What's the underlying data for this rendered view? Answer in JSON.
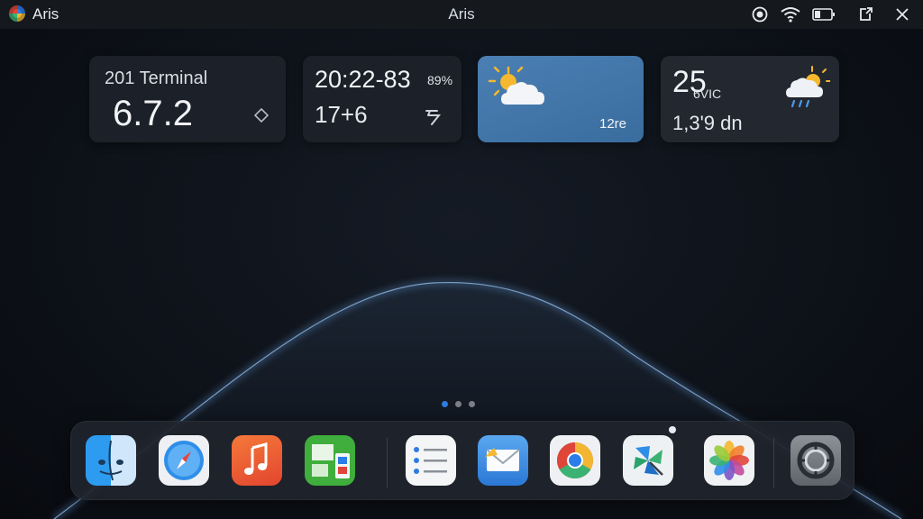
{
  "titlebar": {
    "app_name": "Aris",
    "window_title": "Aris",
    "controls": [
      "record-icon",
      "wifi-icon",
      "battery-icon",
      "share-icon",
      "close-icon"
    ]
  },
  "widgets": {
    "terminal": {
      "title": "201 Terminal",
      "value": "6.7.2"
    },
    "clock": {
      "time": "20:22-83",
      "percent": "89%",
      "secondary": "17+6"
    },
    "weather_sunny": {
      "value": "12re"
    },
    "weather_rain": {
      "temp": "25",
      "sub": "6VIC",
      "value": "1,3'9 dn"
    }
  },
  "pager": {
    "pages": 3,
    "active": 0
  },
  "dock": {
    "apps": [
      "finder-icon",
      "safari-compass-icon",
      "music-icon",
      "numbers-icon",
      "reminders-list-icon",
      "mail-icon",
      "chrome-icon",
      "pinwheel-icon",
      "photos-icon",
      "settings-icon"
    ]
  },
  "colors": {
    "accent": "#2f7bdf",
    "weather_tile": "#4a7db0"
  }
}
